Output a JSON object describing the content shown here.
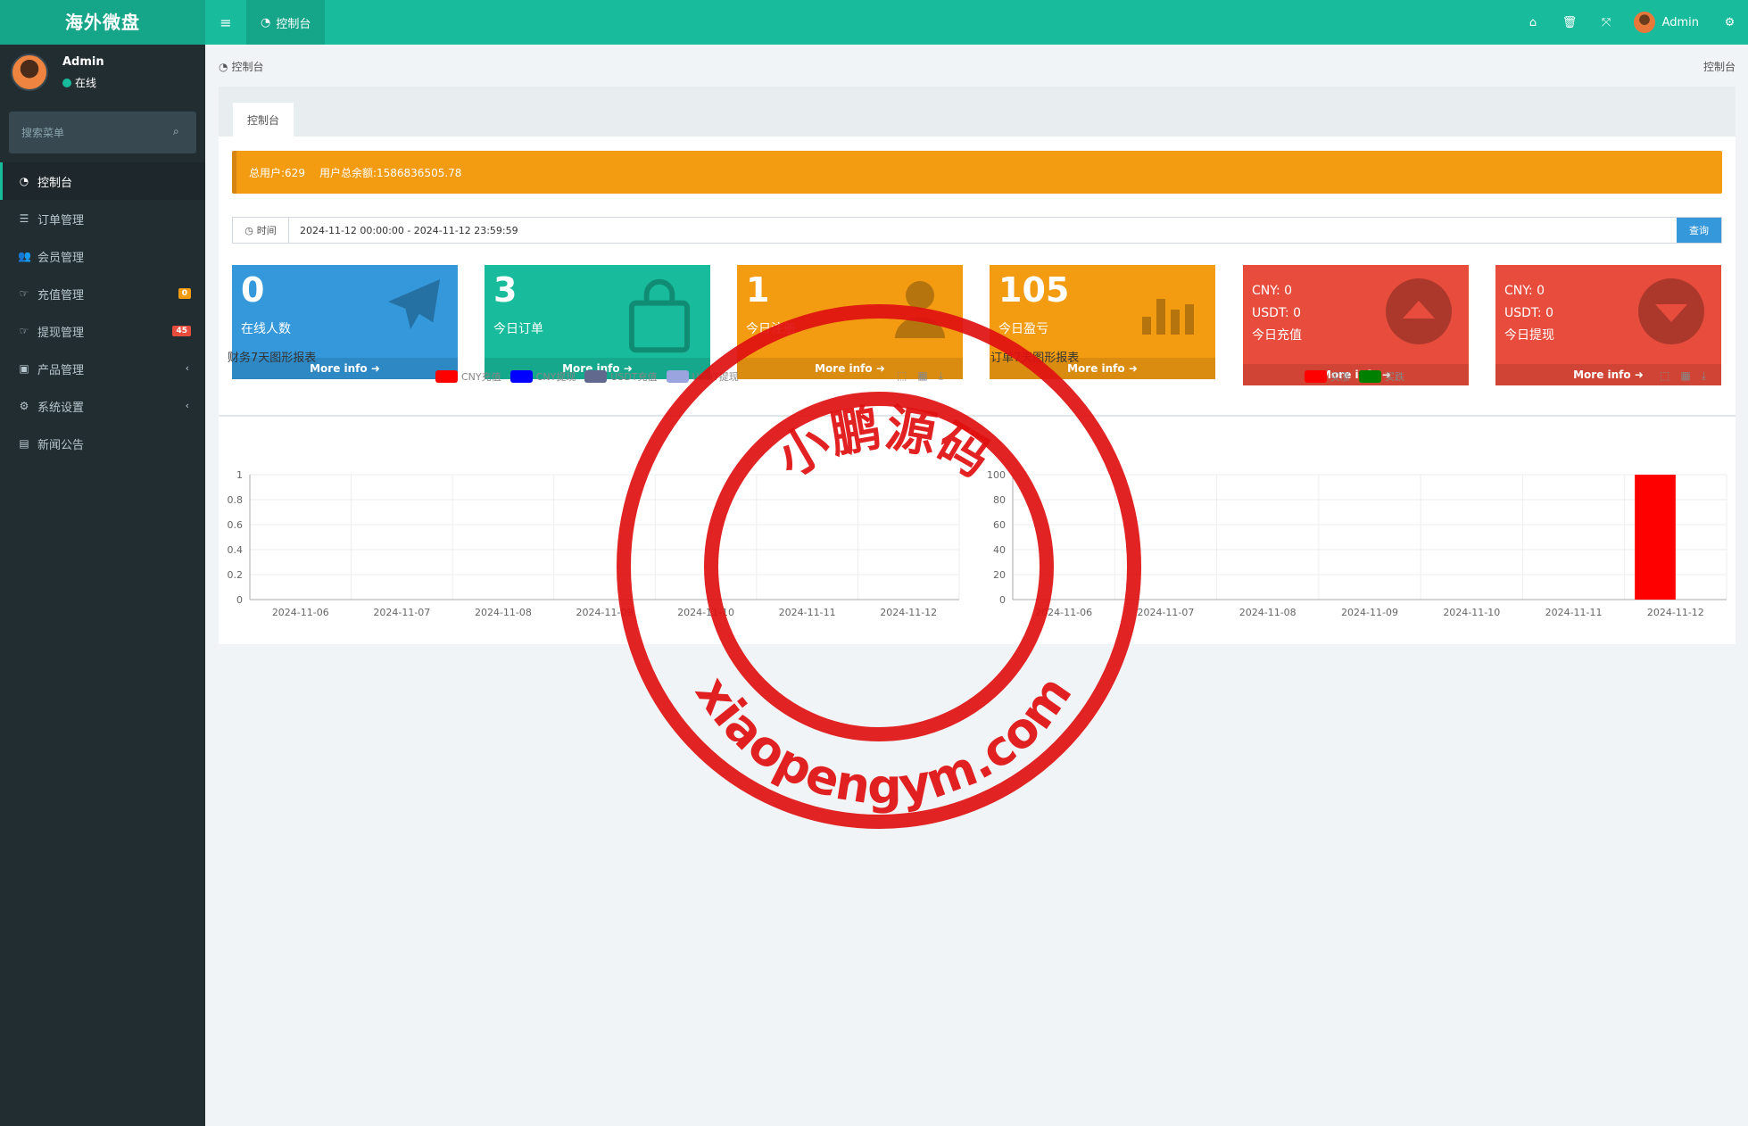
{
  "header": {
    "logo": "海外微盘",
    "tab_label": "控制台",
    "user_name": "Admin"
  },
  "sidebar": {
    "user_name": "Admin",
    "status": "在线",
    "search_placeholder": "搜索菜单",
    "items": [
      {
        "label": "控制台",
        "icon": "dashboard-icon"
      },
      {
        "label": "订单管理",
        "icon": "list-icon"
      },
      {
        "label": "会员管理",
        "icon": "users-icon"
      },
      {
        "label": "充值管理",
        "icon": "hand-icon",
        "badge": "0"
      },
      {
        "label": "提现管理",
        "icon": "hand-icon",
        "badge": "45"
      },
      {
        "label": "产品管理",
        "icon": "shopping-bag-icon"
      },
      {
        "label": "系统设置",
        "icon": "cogs-icon"
      },
      {
        "label": "新闻公告",
        "icon": "newspaper-icon"
      }
    ]
  },
  "breadcrumb": {
    "left": "控制台",
    "right": "控制台"
  },
  "panel": {
    "tab": "控制台",
    "alert_users": "总用户:629",
    "alert_balance": "用户总余额:1586836505.78",
    "filter_label": "时间",
    "filter_value": "2024-11-12 00:00:00 - 2024-11-12 23:59:59",
    "filter_button": "查询"
  },
  "stats": [
    {
      "value": "0",
      "label": "在线人数",
      "more": "More info",
      "color": "#3498db"
    },
    {
      "value": "3",
      "label": "今日订单",
      "more": "More info",
      "color": "#18bc9c"
    },
    {
      "value": "1",
      "label": "今日注册",
      "more": "More info",
      "color": "#f39c12"
    },
    {
      "value": "105",
      "label": "今日盈亏",
      "more": "More info",
      "color": "#f39c12"
    },
    {
      "line1": "CNY:  0",
      "line2": "USDT:  0",
      "label": "今日充值",
      "more": "More info",
      "color": "#e74c3c"
    },
    {
      "line1": "CNY:  0",
      "line2": "USDT:  0",
      "label": "今日提现",
      "more": "More info",
      "color": "#e74c3c"
    }
  ],
  "stamp": {
    "top_text": "小鹏源码",
    "bottom_text": "xiaopengym.com"
  },
  "chart_data": [
    {
      "type": "line",
      "title": "财务7天图形报表",
      "categories": [
        "2024-11-06",
        "2024-11-07",
        "2024-11-08",
        "2024-11-09",
        "2024-11-10",
        "2024-11-11",
        "2024-11-12"
      ],
      "series": [
        {
          "name": "CNY充值",
          "color": "#ff0000",
          "values": [
            0,
            0,
            0,
            0,
            0,
            0,
            0
          ]
        },
        {
          "name": "CNY提现",
          "color": "#0000ff",
          "values": [
            0,
            0,
            0,
            0,
            0,
            0,
            0
          ]
        },
        {
          "name": "USDT充值",
          "color": "#61698e",
          "values": [
            0,
            0,
            0,
            0,
            0,
            0,
            0
          ]
        },
        {
          "name": "USDT提现",
          "color": "#9aa5e0",
          "values": [
            0,
            0,
            0,
            0,
            0,
            0,
            0
          ]
        }
      ],
      "yticks": [
        "0",
        "0.2",
        "0.4",
        "0.6",
        "0.8",
        "1"
      ],
      "ylim": [
        0,
        1
      ]
    },
    {
      "type": "bar",
      "title": "订单7天图形报表",
      "categories": [
        "2024-11-06",
        "2024-11-07",
        "2024-11-08",
        "2024-11-09",
        "2024-11-10",
        "2024-11-11",
        "2024-11-12"
      ],
      "series": [
        {
          "name": "买涨",
          "color": "#ff0000",
          "values": [
            0,
            0,
            0,
            0,
            0,
            0,
            100
          ]
        },
        {
          "name": "买跌",
          "color": "#008000",
          "values": [
            0,
            0,
            0,
            0,
            0,
            0,
            0
          ]
        }
      ],
      "yticks": [
        "0",
        "20",
        "40",
        "60",
        "80",
        "100"
      ],
      "ylim": [
        0,
        100
      ]
    }
  ]
}
